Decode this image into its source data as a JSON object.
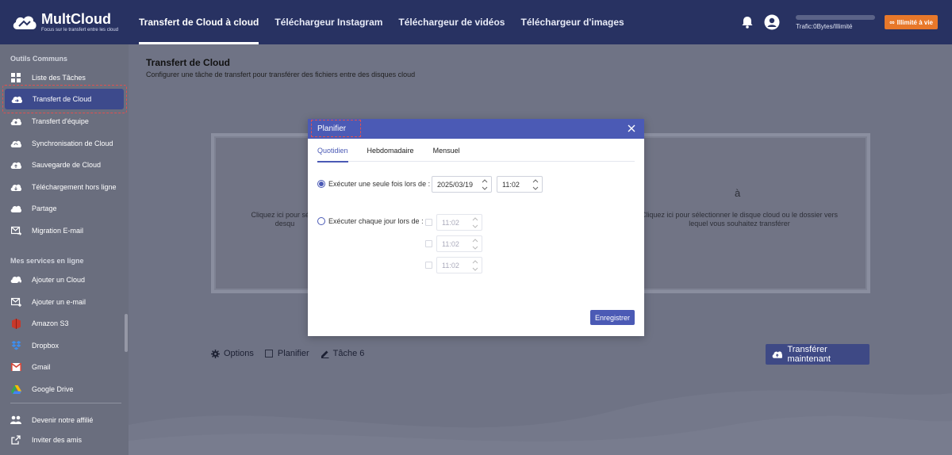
{
  "app": {
    "name": "MultCloud",
    "tagline": "Focus sur le transfert entre les cloud"
  },
  "topnav": {
    "items": [
      {
        "label": "Transfert de Cloud à cloud",
        "active": true
      },
      {
        "label": "Téléchargeur Instagram",
        "active": false
      },
      {
        "label": "Téléchargeur de vidéos",
        "active": false
      },
      {
        "label": "Téléchargeur d'images",
        "active": false
      }
    ],
    "traffic": "Trafic:0Bytes/Illimité",
    "unlimited_label": "Illimité à vie"
  },
  "sidebar": {
    "section1": "Outils Communs",
    "items1": [
      {
        "label": "Liste des Tâches",
        "icon": "grid-icon"
      },
      {
        "label": "Transfert de Cloud",
        "icon": "cloud-transfer-icon",
        "active": true
      },
      {
        "label": "Transfert d'équipe",
        "icon": "team-transfer-icon"
      },
      {
        "label": "Synchronisation de Cloud",
        "icon": "cloud-sync-icon"
      },
      {
        "label": "Sauvegarde de Cloud",
        "icon": "cloud-backup-icon"
      },
      {
        "label": "Téléchargement hors ligne",
        "icon": "cloud-download-icon"
      },
      {
        "label": "Partage",
        "icon": "share-icon"
      },
      {
        "label": "Migration E-mail",
        "icon": "email-migration-icon"
      }
    ],
    "section2": "Mes services en ligne",
    "items2": [
      {
        "label": "Ajouter un Cloud",
        "icon": "add-cloud-icon"
      },
      {
        "label": "Ajouter un e-mail",
        "icon": "add-email-icon"
      },
      {
        "label": "Amazon S3",
        "icon": "amazon-s3-icon"
      },
      {
        "label": "Dropbox",
        "icon": "dropbox-icon"
      },
      {
        "label": "Gmail",
        "icon": "gmail-icon"
      },
      {
        "label": "Google Drive",
        "icon": "google-drive-icon"
      }
    ],
    "items3": [
      {
        "label": "Devenir notre affilié",
        "icon": "affiliate-icon"
      },
      {
        "label": "Inviter des amis",
        "icon": "invite-icon"
      }
    ]
  },
  "main": {
    "title": "Transfert de Cloud",
    "subtitle": "Configurer une tâche de transfert pour transférer des fichiers entre des disques cloud",
    "source_hint": "Cliquez ici pour sélectionner le disque cloud ou le dossier que vous souhaitez transférer",
    "source_hint_visible": "Cliquez ici pour sélec\ndesqu",
    "dest_arrow": "à",
    "dest_hint": "Cliquez ici pour sélectionner le disque cloud ou le dossier vers lequel vous souhaitez transférer",
    "options_label": "Options",
    "schedule_label": "Planifier",
    "task_label": "Tâche 6",
    "transfer_button": "Transférer maintenant"
  },
  "modal": {
    "title": "Planifier",
    "tabs": [
      {
        "label": "Quotidien",
        "active": true
      },
      {
        "label": "Hebdomadaire",
        "active": false
      },
      {
        "label": "Mensuel",
        "active": false
      }
    ],
    "once_label": "Exécuter une seule fois lors de :",
    "once_date": "2025/03/19",
    "once_time": "11:02",
    "daily_label": "Exécuter chaque jour lors de :",
    "daily_times": [
      "11:02",
      "11:02",
      "11:02"
    ],
    "save_label": "Enregistrer"
  },
  "colors": {
    "topbar": "#283262",
    "accent": "#4b5ab5",
    "orange": "#e8782a"
  }
}
